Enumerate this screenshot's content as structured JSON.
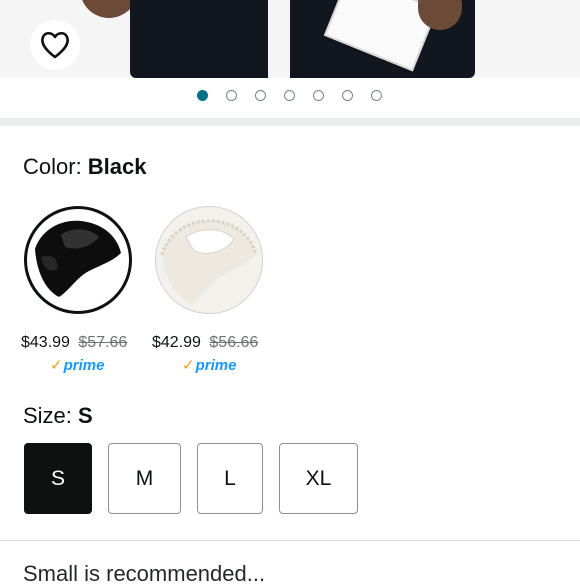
{
  "product_image": {
    "wishlist_icon": "heart-outline-icon",
    "carousel": {
      "total": 7,
      "active_index": 0
    }
  },
  "color": {
    "label": "Color: ",
    "selected": "Black",
    "options": [
      {
        "name": "Black",
        "price": "$43.99",
        "list_price": "$57.66",
        "prime": "prime"
      },
      {
        "name": "White",
        "price": "$42.99",
        "list_price": "$56.66",
        "prime": "prime"
      }
    ]
  },
  "size": {
    "label": "Size: ",
    "selected": "S",
    "options": [
      "S",
      "M",
      "L",
      "XL"
    ]
  },
  "below_fold_text": "Small is recommended..."
}
